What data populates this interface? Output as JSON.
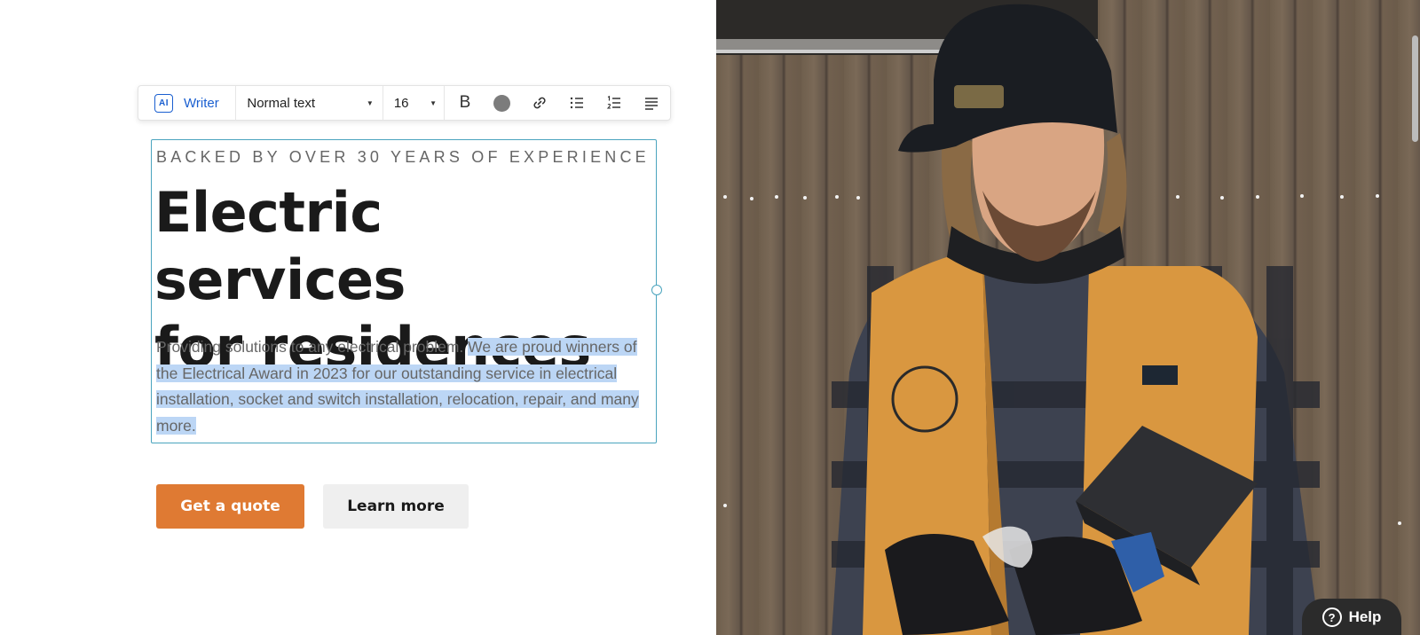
{
  "toolbar": {
    "ai_badge": "AI",
    "writer_label": "Writer",
    "text_style": "Normal text",
    "font_size": "16",
    "bold_glyph": "B",
    "icons": [
      "bold-icon",
      "text-color-icon",
      "link-icon",
      "bullet-list-icon",
      "numbered-list-icon",
      "align-icon"
    ]
  },
  "hero": {
    "eyebrow": "BACKED BY OVER 30 YEARS OF EXPERIENCE",
    "headline_line1": "Electric services",
    "headline_line2": "for residences",
    "body_plain": "Providing solutions to any electrical problem. ",
    "body_selected": "We are proud winners of the Electrical Award in 2023 for our outstanding service in electrical installation, socket and switch installation, relocation, repair, and many more."
  },
  "buttons": {
    "primary": "Get a quote",
    "secondary": "Learn more"
  },
  "help": {
    "label": "Help",
    "icon_glyph": "?"
  },
  "colors": {
    "accent_orange": "#df7a33",
    "writer_blue": "#1a5fd0",
    "selection_border": "#4aa4be",
    "selection_highlight": "#bcd6f5"
  }
}
